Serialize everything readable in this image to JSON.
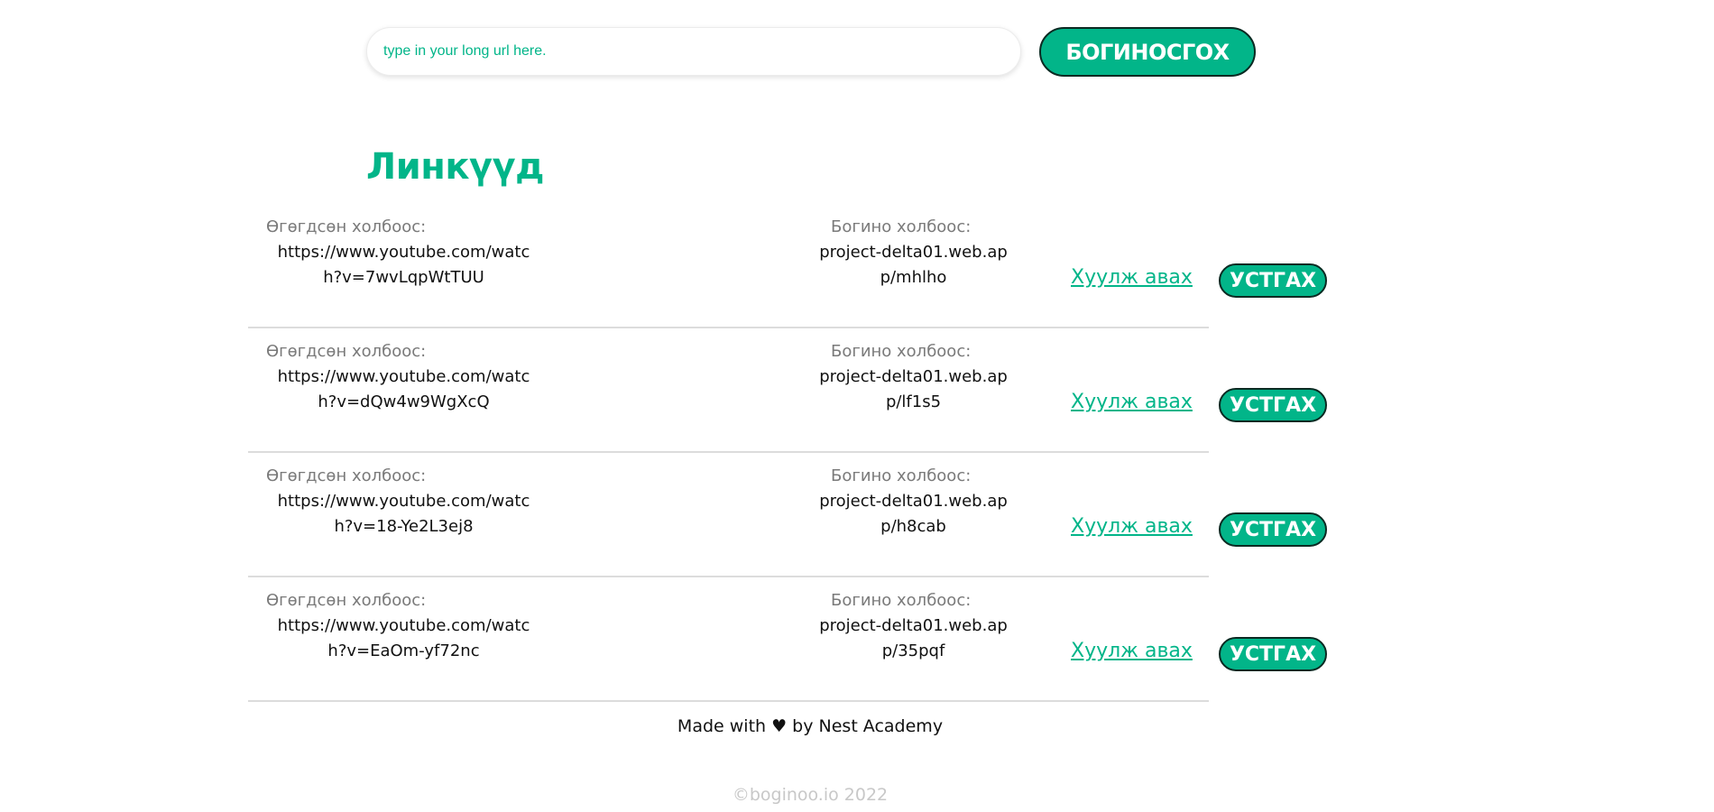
{
  "search": {
    "placeholder": "type in your long url here.",
    "button_label": "БОГИНОСГОХ"
  },
  "links_title": "Линкүүд",
  "row_labels": {
    "original": "Өгөгдсөн холбоос:",
    "short": "Богино холбоос:",
    "open": "Хуулж авах",
    "delete": "УСТГАХ"
  },
  "links": [
    {
      "original": "https://www.youtube.com/watch?v=7wvLqpWtTUU",
      "short": "project-delta01.web.app/mhlho"
    },
    {
      "original": "https://www.youtube.com/watch?v=dQw4w9WgXcQ",
      "short": "project-delta01.web.app/lf1s5"
    },
    {
      "original": "https://www.youtube.com/watch?v=18-Ye2L3ej8",
      "short": "project-delta01.web.app/h8cab"
    },
    {
      "original": "https://www.youtube.com/watch?v=EaOm-yf72nc",
      "short": "project-delta01.web.app/35pqf"
    }
  ],
  "footer": {
    "made_with": "Made with ♥ by Nest Academy",
    "copyright": "©boginoo.io 2022"
  },
  "colors": {
    "accent": "#02b589",
    "button_border": "#0b2a22",
    "divider": "#dcdcdc",
    "muted_text": "#7a7a7a"
  }
}
